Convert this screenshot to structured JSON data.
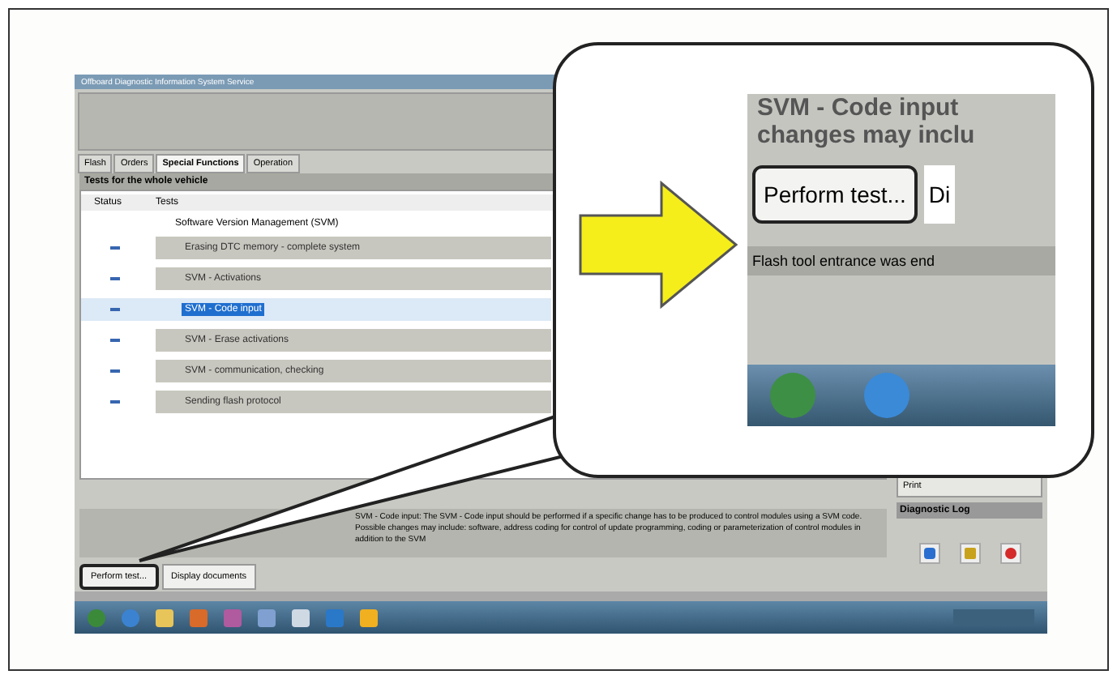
{
  "window": {
    "title": "Offboard Diagnostic Information System Service"
  },
  "tabs": [
    {
      "label": "Flash",
      "selected": false
    },
    {
      "label": "Orders",
      "selected": false
    },
    {
      "label": "Special Functions",
      "selected": true
    },
    {
      "label": "Operation",
      "selected": false
    }
  ],
  "section_title": "Tests for the whole vehicle",
  "table": {
    "columns": [
      "Status",
      "Tests"
    ],
    "group": "Software Version Management (SVM)",
    "rows": [
      {
        "test": "Erasing DTC memory - complete system",
        "selected": false
      },
      {
        "test": "SVM - Activations",
        "selected": false
      },
      {
        "test": "SVM - Code input",
        "selected": true
      },
      {
        "test": "SVM - Erase activations",
        "selected": false
      },
      {
        "test": "SVM - communication, checking",
        "selected": false
      },
      {
        "test": "Sending flash protocol",
        "selected": false
      }
    ]
  },
  "description": "SVM - Code input: The SVM - Code input should be performed if a specific change has to be produced to control modules using a SVM code. Possible changes may include: software, address coding for control of update programming, coding or parameterization of control modules in addition to the SVM",
  "buttons": [
    {
      "label": "Perform test...",
      "outlined": true
    },
    {
      "label": "Display documents",
      "outlined": false
    }
  ],
  "side_panel": {
    "buttons": [
      "Print"
    ],
    "log_title": "Diagnostic Log"
  },
  "callout": {
    "lines": [
      "SVM - Code input",
      "changes may inclu"
    ],
    "button": "Perform test...",
    "next_button": "Di",
    "status": "Flash tool entrance was end"
  }
}
